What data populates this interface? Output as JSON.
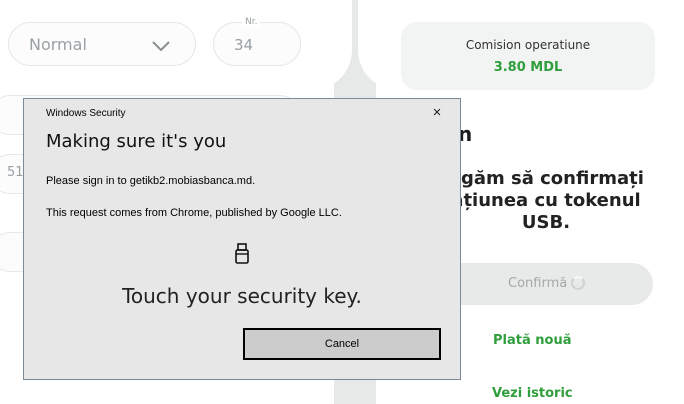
{
  "background": {
    "priority_select": {
      "value": "Normal"
    },
    "number_field": {
      "label": "Nr.",
      "value": "34"
    },
    "partial_field_text": "51",
    "commission": {
      "label": "Comision operatiune",
      "value": "3.80 MDL"
    },
    "heading_fragment": "n",
    "confirm_message_lines": [
      "ugăm să confirmați",
      "ațiunea cu tokenul",
      "USB."
    ],
    "confirm_button_label": "Confirmă",
    "links": {
      "new_payment": "Plată nouă",
      "view_history": "Vezi istoric"
    },
    "accent_color": "#2f9e3c"
  },
  "dialog": {
    "title": "Windows Security",
    "close_glyph": "×",
    "heading": "Making sure it's you",
    "line1": "Please sign in to getikb2.mobiasbanca.md.",
    "line2": "This request comes from Chrome, published by Google LLC.",
    "icon": "usb-security-key-icon",
    "instruction": "Touch your security key.",
    "cancel_label": "Cancel"
  }
}
